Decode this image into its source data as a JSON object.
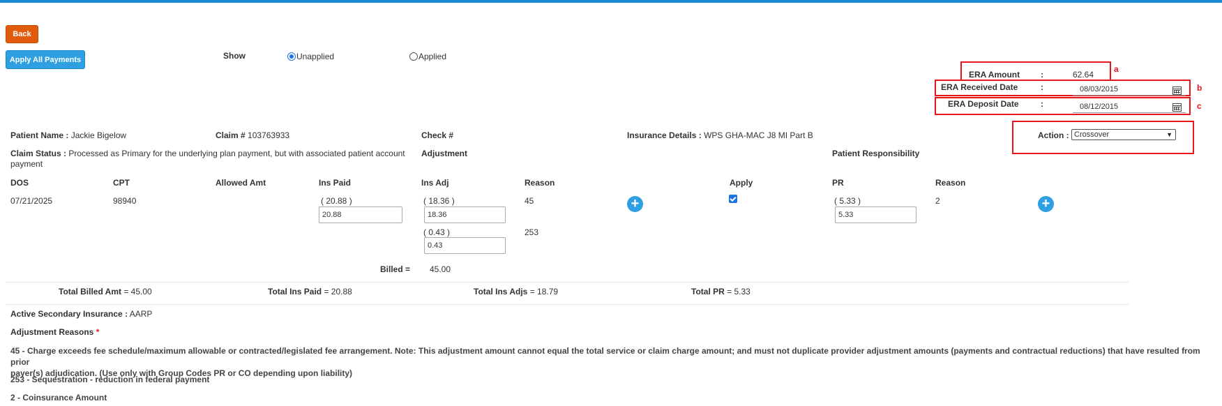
{
  "toolbar": {
    "back_label": "Back",
    "apply_all_label": "Apply All Payments"
  },
  "filter": {
    "show_label": "Show",
    "options": [
      {
        "label": "Unapplied",
        "selected": true
      },
      {
        "label": "Applied",
        "selected": false
      }
    ]
  },
  "era": {
    "amount_label": "ERA Amount",
    "amount_value": "62.64",
    "received_label": "ERA Received Date",
    "received_value": "08/03/2015",
    "deposit_label": "ERA Deposit Date",
    "deposit_value": "08/12/2015",
    "colon": ":",
    "marks": {
      "a": "a",
      "b": "b",
      "c": "c"
    }
  },
  "claim": {
    "patient_name_label": "Patient Name :",
    "patient_name": "Jackie Bigelow",
    "claim_label": "Claim #",
    "claim_number": "103763933",
    "check_label": "Check #",
    "insurance_label": "Insurance Details :",
    "insurance_value": "WPS GHA-MAC J8 MI Part B",
    "action_label": "Action :",
    "action_value": "Crossover",
    "status_label": "Claim Status :",
    "status_value_line1": "Processed as Primary for the underlying plan payment, but with associated patient account",
    "status_value_line2": "payment",
    "adjustment_header": "Adjustment",
    "patient_resp_header": "Patient Responsibility"
  },
  "table": {
    "headers": {
      "dos": "DOS",
      "cpt": "CPT",
      "allowed": "Allowed Amt",
      "ins_paid": "Ins Paid",
      "ins_adj": "Ins Adj",
      "reason": "Reason",
      "apply": "Apply",
      "pr": "PR",
      "pr_reason": "Reason"
    },
    "row": {
      "dos": "07/21/2025",
      "cpt": "98940",
      "ins_paid_display": "( 20.88 )",
      "ins_paid_input": "20.88",
      "adj1_display": "( 18.36 )",
      "adj1_input": "18.36",
      "adj1_reason": "45",
      "adj2_display": "( 0.43 )",
      "adj2_input": "0.43",
      "adj2_reason": "253",
      "apply_checked": true,
      "pr_display": "( 5.33 )",
      "pr_input": "5.33",
      "pr_reason": "2"
    },
    "billed_label": "Billed =",
    "billed_value": "45.00"
  },
  "totals": {
    "billed_label": "Total Billed Amt",
    "billed_value": "= 45.00",
    "ins_paid_label": "Total Ins Paid",
    "ins_paid_value": "= 20.88",
    "ins_adjs_label": "Total Ins Adjs",
    "ins_adjs_value": "= 18.79",
    "pr_label": "Total PR",
    "pr_value": "= 5.33"
  },
  "secondary": {
    "label": "Active Secondary Insurance :",
    "value": "AARP"
  },
  "reasons": {
    "title": "Adjustment Reasons",
    "required_mark": "*",
    "r45_line1": "45 - Charge exceeds fee schedule/maximum allowable or contracted/legislated fee arrangement. Note: This adjustment amount cannot equal the total service or claim charge amount; and must not duplicate provider adjustment amounts (payments and contractual reductions) that have resulted from prior",
    "r45_line2": "payer(s) adjudication. (Use only with Group Codes PR or CO depending upon liability)",
    "r253": "253 - Sequestration - reduction in federal payment",
    "r2": "2 - Coinsurance Amount"
  },
  "colors": {
    "accent": "#1a8ad3",
    "back_button": "#e25a0c",
    "apply_button": "#2e9fe0",
    "highlight": "#e8141c"
  },
  "icons": [
    "calendar-icon",
    "plus-circle-icon",
    "chevron-down-icon",
    "checkbox-checked-icon"
  ]
}
